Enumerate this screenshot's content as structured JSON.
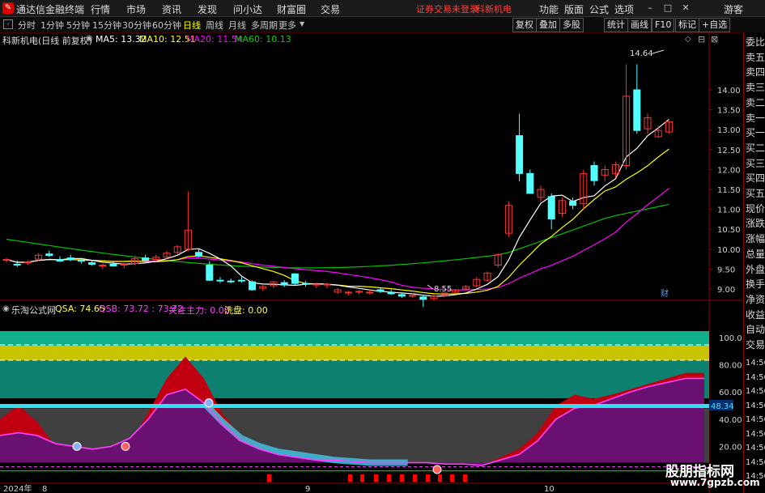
{
  "titlebar": {
    "app_title": "通达信金融终端",
    "menus": [
      "行情",
      "市场",
      "资讯",
      "发现",
      "问小达",
      "财富圈",
      "交易"
    ],
    "warning": "证券交易未登录",
    "stock": "科新机电",
    "right_menus": [
      "功能",
      "版面",
      "公式",
      "选项"
    ],
    "user": "游客"
  },
  "toolbar": {
    "periods": [
      "分时",
      "1分钟",
      "5分钟",
      "15分钟",
      "30分钟",
      "60分钟",
      "日线",
      "周线",
      "月线",
      "多周期",
      "更多"
    ],
    "active_period": "日线",
    "right_buttons": [
      "复权",
      "叠加",
      "多股",
      "统计",
      "画线",
      "F10",
      "标记",
      "+自选"
    ]
  },
  "main_legend": {
    "stock_title": "科新机电(日线 前复权)",
    "ma5": "MA5: 13.32",
    "ma10": "MA10: 12.51",
    "ma20": "MA20: 11.54",
    "ma60": "MA60: 10.13"
  },
  "indicator_legend": {
    "name": "乐淘公式网",
    "qsa": "QSA: 74.65",
    "qsb": "QSB: 73.72 : 73.72",
    "focus": "关注主力: 0.00",
    "wash": "洗盘: 0.00"
  },
  "price_axis": [
    "14.00",
    "13.50",
    "13.00",
    "12.50",
    "12.00",
    "11.50",
    "11.00",
    "10.50",
    "10.00",
    "9.50",
    "9.00"
  ],
  "indicator_axis": [
    "100.0",
    "80.00",
    "60.00",
    "40.00",
    "20.00"
  ],
  "indicator_marker": "48.34",
  "annotations": {
    "high": "14.64",
    "low": "8.55",
    "cai": "财"
  },
  "date_axis": {
    "year": "2024年",
    "m8": "8",
    "m9": "9",
    "m10": "10"
  },
  "side_panel": [
    "委比",
    "卖五",
    "卖四",
    "卖三",
    "卖二",
    "卖一",
    "买一",
    "买二",
    "买三",
    "买四",
    "买五",
    "现价",
    "涨跌",
    "涨幅",
    "总量",
    "外盘",
    "换手",
    "净资",
    "收益",
    "自动",
    "交易"
  ],
  "side_times": [
    "14:56",
    "14:56",
    "14:56",
    "14:56",
    "14:56",
    "14:56",
    "14:56",
    "14:56",
    "14:56"
  ],
  "watermark": {
    "line1": "股朋指标网",
    "line2": "www.7gpzb.com"
  },
  "colors": {
    "up": "#ff3232",
    "down": "#54ffff",
    "ma5": "#ffffff",
    "ma10": "#ffff00",
    "ma20": "#ff00ff",
    "ma60": "#00c000"
  },
  "chart_data": {
    "type": "candlestick",
    "candles": [
      [
        9.72,
        9.78,
        9.66,
        9.74
      ],
      [
        9.62,
        9.72,
        9.55,
        9.6
      ],
      [
        9.66,
        9.72,
        9.6,
        9.68
      ],
      [
        9.75,
        9.9,
        9.7,
        9.85
      ],
      [
        9.88,
        9.96,
        9.8,
        9.84
      ],
      [
        9.74,
        9.82,
        9.68,
        9.7
      ],
      [
        9.78,
        9.86,
        9.7,
        9.74
      ],
      [
        9.72,
        9.78,
        9.64,
        9.7
      ],
      [
        9.66,
        9.72,
        9.58,
        9.62
      ],
      [
        9.58,
        9.64,
        9.5,
        9.6
      ],
      [
        9.62,
        9.7,
        9.56,
        9.58
      ],
      [
        9.6,
        9.66,
        9.52,
        9.62
      ],
      [
        9.64,
        9.8,
        9.6,
        9.76
      ],
      [
        9.78,
        9.86,
        9.7,
        9.72
      ],
      [
        9.74,
        9.86,
        9.68,
        9.8
      ],
      [
        9.8,
        9.95,
        9.76,
        9.9
      ],
      [
        9.92,
        10.1,
        9.86,
        10.06
      ],
      [
        10.0,
        11.45,
        9.95,
        10.48
      ],
      [
        9.92,
        10.0,
        9.8,
        9.82
      ],
      [
        9.6,
        9.7,
        9.2,
        9.22
      ],
      [
        9.22,
        9.3,
        9.15,
        9.2
      ],
      [
        9.2,
        9.26,
        9.14,
        9.18
      ],
      [
        9.22,
        9.3,
        9.16,
        9.2
      ],
      [
        9.18,
        9.22,
        8.96,
        8.98
      ],
      [
        9.02,
        9.1,
        8.95,
        9.06
      ],
      [
        9.08,
        9.2,
        9.02,
        9.18
      ],
      [
        9.16,
        9.22,
        9.05,
        9.1
      ],
      [
        9.38,
        9.4,
        9.1,
        9.14
      ],
      [
        9.14,
        9.2,
        9.05,
        9.12
      ],
      [
        9.1,
        9.16,
        9.02,
        9.12
      ],
      [
        9.1,
        9.16,
        9.02,
        9.12
      ],
      [
        8.92,
        9.02,
        8.88,
        8.98
      ],
      [
        8.9,
        8.96,
        8.84,
        8.92
      ],
      [
        8.92,
        8.98,
        8.86,
        8.94
      ],
      [
        8.92,
        8.98,
        8.86,
        8.92
      ],
      [
        8.98,
        9.02,
        8.9,
        8.94
      ],
      [
        8.92,
        8.98,
        8.85,
        8.88
      ],
      [
        8.86,
        8.92,
        8.78,
        8.82
      ],
      [
        8.84,
        8.9,
        8.78,
        8.84
      ],
      [
        8.8,
        8.86,
        8.55,
        8.74
      ],
      [
        8.76,
        8.86,
        8.72,
        8.82
      ],
      [
        8.84,
        8.92,
        8.8,
        8.9
      ],
      [
        8.92,
        9.0,
        8.88,
        8.98
      ],
      [
        9.0,
        9.1,
        8.96,
        9.06
      ],
      [
        9.08,
        9.3,
        9.04,
        9.24
      ],
      [
        9.22,
        9.44,
        9.18,
        9.4
      ],
      [
        9.6,
        9.9,
        9.54,
        9.86
      ],
      [
        10.4,
        11.2,
        10.3,
        11.1
      ],
      [
        12.85,
        13.4,
        11.7,
        11.9
      ],
      [
        11.9,
        12.0,
        11.6,
        11.4
      ],
      [
        11.3,
        11.6,
        11.2,
        11.5
      ],
      [
        11.32,
        11.4,
        10.5,
        10.76
      ],
      [
        10.9,
        11.3,
        10.8,
        11.22
      ],
      [
        11.2,
        11.3,
        11.0,
        11.1
      ],
      [
        11.14,
        12.0,
        11.0,
        11.9
      ],
      [
        12.1,
        12.2,
        11.6,
        11.72
      ],
      [
        11.86,
        12.1,
        11.7,
        12.0
      ],
      [
        11.9,
        12.2,
        11.8,
        12.12
      ],
      [
        12.1,
        14.64,
        12.0,
        13.84
      ],
      [
        14.0,
        14.64,
        12.9,
        12.98
      ],
      [
        13.02,
        13.4,
        12.9,
        13.3
      ],
      [
        12.82,
        13.1,
        12.8,
        12.98
      ],
      [
        12.94,
        13.2,
        12.9,
        13.2
      ]
    ]
  }
}
